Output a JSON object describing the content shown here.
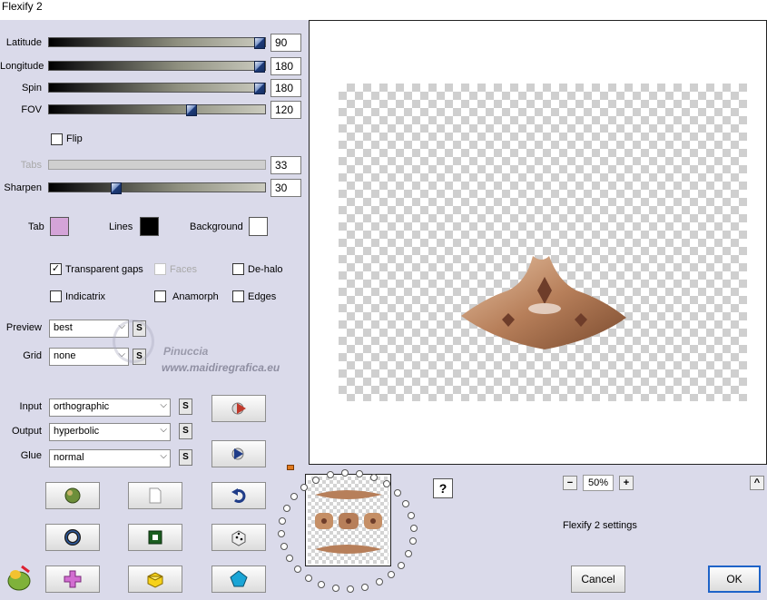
{
  "window": {
    "title": "Flexify 2"
  },
  "sliders": [
    {
      "label": "Latitude",
      "value": "90",
      "fraction": 1.0
    },
    {
      "label": "Longitude",
      "value": "180",
      "fraction": 1.0
    },
    {
      "label": "Spin",
      "value": "180",
      "fraction": 1.0
    },
    {
      "label": "FOV",
      "value": "120",
      "fraction": 0.67
    },
    {
      "label": "Tabs",
      "value": "33",
      "fraction": 0.0,
      "disabled": true
    },
    {
      "label": "Sharpen",
      "value": "30",
      "fraction": 0.3
    }
  ],
  "flip": {
    "label": "Flip",
    "checked": false
  },
  "colors": {
    "tab": {
      "label": "Tab",
      "color": "#d4a4d8"
    },
    "lines": {
      "label": "Lines",
      "color": "#000000"
    },
    "background": {
      "label": "Background",
      "color": "#ffffff"
    }
  },
  "options": {
    "transparent_gaps": {
      "label": "Transparent gaps",
      "checked": true
    },
    "faces": {
      "label": "Faces",
      "checked": false,
      "disabled": true
    },
    "de_halo": {
      "label": "De-halo",
      "checked": false
    },
    "indicatrix": {
      "label": "Indicatrix",
      "checked": false
    },
    "anamorph": {
      "label": "Anamorph",
      "checked": false
    },
    "edges": {
      "label": "Edges",
      "checked": false
    }
  },
  "selects": {
    "preview": {
      "label": "Preview",
      "value": "best"
    },
    "grid": {
      "label": "Grid",
      "value": "none"
    },
    "input": {
      "label": "Input",
      "value": "orthographic"
    },
    "output": {
      "label": "Output",
      "value": "hyperbolic"
    },
    "glue": {
      "label": "Glue",
      "value": "normal"
    }
  },
  "s_label": "S",
  "watermark": {
    "name": "Pinuccia",
    "url": "www.maidiregrafica.eu"
  },
  "zoom": {
    "minus": "−",
    "value": "50%",
    "plus": "+"
  },
  "help": "?",
  "collapse": "^",
  "settings_label": "Flexify 2 settings",
  "cancel_label": "Cancel",
  "ok_label": "OK",
  "icons": {
    "color": "#c0392b"
  }
}
